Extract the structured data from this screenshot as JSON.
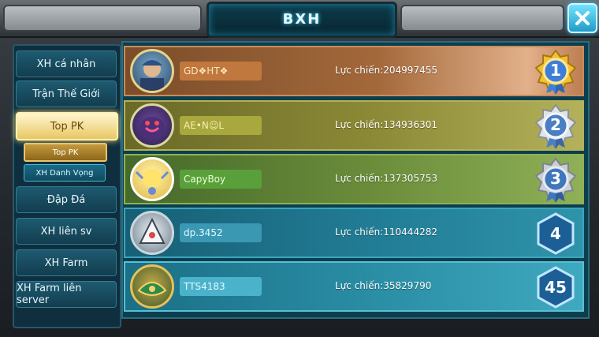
{
  "header": {
    "title": "BXH"
  },
  "colors": {
    "accent": "#1ec8ff",
    "gold": "#e8c764"
  },
  "sidebar": {
    "items": [
      {
        "label": "XH cá nhân"
      },
      {
        "label": "Trận Thế Giới"
      },
      {
        "label": "Top PK"
      },
      {
        "label": "Đập Đá"
      },
      {
        "label": "XH liên sv"
      },
      {
        "label": "XH Farm"
      },
      {
        "label": "XH Farm liên server"
      }
    ],
    "subitems": [
      {
        "label": "Top PK"
      },
      {
        "label": "XH Danh Vọng"
      }
    ]
  },
  "ranking": {
    "rows": [
      {
        "rank": "1",
        "name": "GD❖HT❖",
        "power": "Lực chiến:204997455",
        "medal": "gold-medal-icon"
      },
      {
        "rank": "2",
        "name": "AE•N☺L",
        "power": "Lực chiến:134936301",
        "medal": "silver-medal-icon"
      },
      {
        "rank": "3",
        "name": "CapyBoy",
        "power": "Lực chiến:137305753",
        "medal": "bronze-medal-icon"
      },
      {
        "rank": "4",
        "name": "dp.3452",
        "power": "Lực chiến:110444282",
        "medal": "hexagon-badge-icon"
      },
      {
        "rank": "45",
        "name": "TTS4183",
        "power": "Lực chiến:35829790",
        "medal": "hexagon-badge-icon"
      }
    ]
  }
}
